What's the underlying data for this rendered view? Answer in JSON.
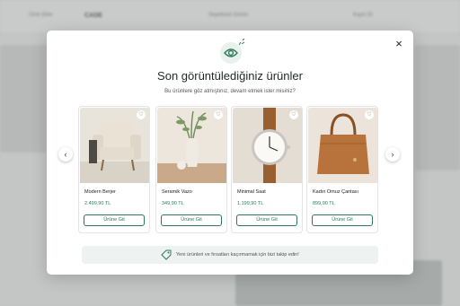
{
  "background": {
    "nav_left": "Ürün Ekle",
    "brand": "CADE",
    "nav_mid": "Sepetinizi Görün",
    "nav_right": "Kayıt Ol"
  },
  "modal": {
    "title": "Son görüntülediğiniz ürünler",
    "subtitle": "Bu ürünlere göz atmıştınız, devam etmek ister misiniz?",
    "close_label": "×",
    "banner_text": "Yeni ürünleri ve fırsatları kaçırmamak için bizi takip edin!"
  },
  "products": [
    {
      "name": "Modern Berjer",
      "price": "2.499,90 TL",
      "button": "Ürüne Git",
      "image": "armchair"
    },
    {
      "name": "Seramik Vazo",
      "price": "349,90 TL",
      "button": "Ürüne Git",
      "image": "vase"
    },
    {
      "name": "Minimal Saat",
      "price": "1.199,90 TL",
      "button": "Ürüne Git",
      "image": "watch"
    },
    {
      "name": "Kadın Omuz Çantası",
      "price": "899,90 TL",
      "button": "Ürüne Git",
      "image": "handbag"
    }
  ],
  "colors": {
    "accent": "#2f7a5a",
    "banner_bg": "#eef2f0"
  }
}
